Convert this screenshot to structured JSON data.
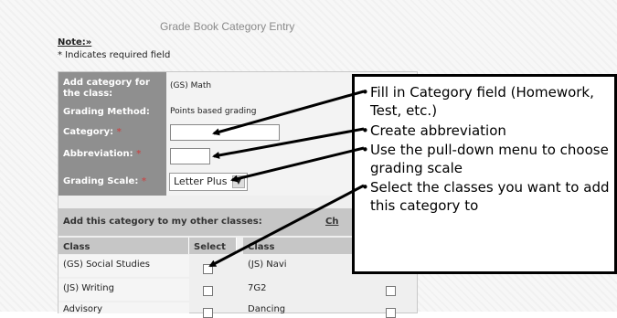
{
  "page": {
    "title": "Grade Book Category Entry",
    "note_label": "Note:»",
    "required_note": "* Indicates required field"
  },
  "form": {
    "add_category_label": "Add category for the class:",
    "add_category_value": "(GS) Math",
    "grading_method_label": "Grading Method:",
    "grading_method_value": "Points based grading",
    "category_label": "Category:",
    "category_value": "",
    "abbreviation_label": "Abbreviation:",
    "abbreviation_value": "",
    "grading_scale_label": "Grading Scale:",
    "grading_scale_value": "Letter Plus",
    "required_star": "*"
  },
  "other_classes": {
    "header": "Add this category to my other classes:",
    "link": "Ch",
    "col_class": "Class",
    "col_select": "Select",
    "col_class2": "Class",
    "rows_left": [
      "(GS) Social Studies",
      "(JS) Writing",
      "Advisory"
    ],
    "rows_right": [
      "(JS) Navi",
      "7G2",
      "Dancing"
    ]
  },
  "callout": {
    "items": [
      "Fill in Category field (Homework, Test, etc.)",
      "Create abbreviation",
      "Use the pull-down menu to choose grading scale",
      "Select the classes you want to add this category to"
    ],
    "bullet": "•"
  },
  "colors": {
    "label_bg": "#8f8f8f",
    "header_bg": "#c6c6c6",
    "callout_border": "#000000"
  }
}
